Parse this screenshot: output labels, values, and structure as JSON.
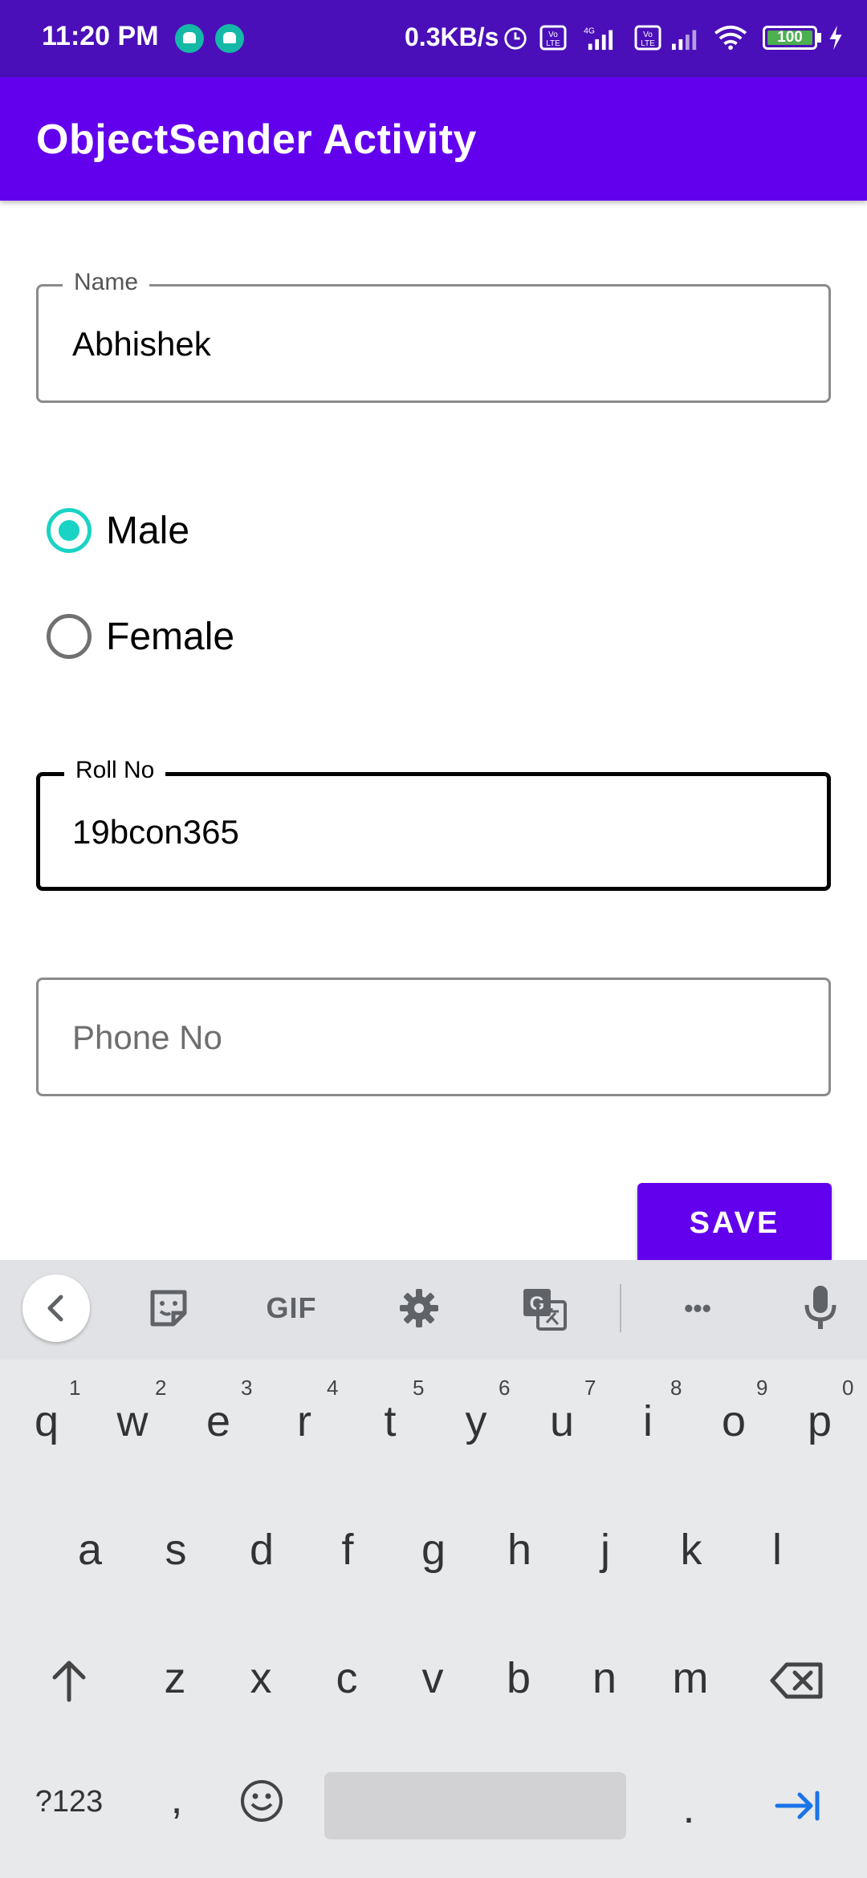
{
  "status_bar": {
    "time": "11:20 PM",
    "network_speed": "0.3KB/s",
    "battery": "100",
    "icons": [
      "android-icon",
      "android-icon",
      "alarm-icon",
      "volte-icon",
      "signal-icon",
      "volte-icon",
      "signal-icon",
      "wifi-icon",
      "battery-icon",
      "charging-icon"
    ]
  },
  "app_bar": {
    "title": "ObjectSender Activity"
  },
  "form": {
    "name_label": "Name",
    "name_value": "Abhishek",
    "gender_options": [
      "Male",
      "Female"
    ],
    "gender_selected": "Male",
    "roll_label": "Roll No",
    "roll_value": "19bcon365",
    "phone_placeholder": "Phone No",
    "save_label": "SAVE"
  },
  "keyboard": {
    "toolbar": {
      "gif_label": "GIF",
      "more_label": "•••"
    },
    "row1_keys": [
      "q",
      "w",
      "e",
      "r",
      "t",
      "y",
      "u",
      "i",
      "o",
      "p"
    ],
    "row1_hints": [
      "1",
      "2",
      "3",
      "4",
      "5",
      "6",
      "7",
      "8",
      "9",
      "0"
    ],
    "row2_keys": [
      "a",
      "s",
      "d",
      "f",
      "g",
      "h",
      "j",
      "k",
      "l"
    ],
    "row3_keys": [
      "z",
      "x",
      "c",
      "v",
      "b",
      "n",
      "m"
    ],
    "symbols_label": "?123",
    "comma_label": ",",
    "period_label": "."
  },
  "colors": {
    "primary": "#6200ee",
    "status_bar": "#4a0fb8",
    "radio_accent": "#19d3c5"
  }
}
